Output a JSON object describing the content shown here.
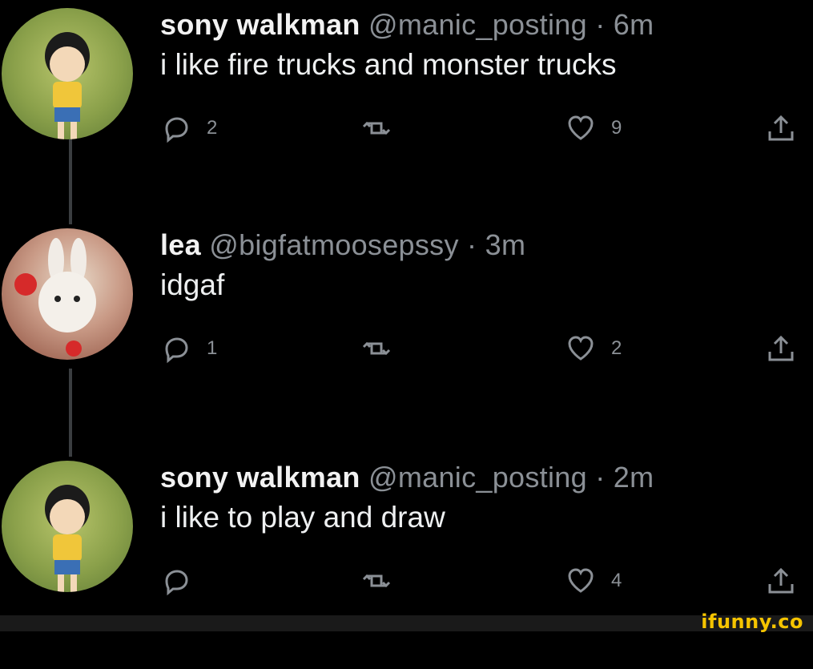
{
  "tweets": [
    {
      "name": "sony walkman",
      "handle": "@manic_posting · 6m",
      "text": "i like fire trucks and monster trucks",
      "replies": "2",
      "retweets": "",
      "likes": "9"
    },
    {
      "name": "lea",
      "handle": "@bigfatmoosepssy · 3m",
      "text": "idgaf",
      "replies": "1",
      "retweets": "",
      "likes": "2"
    },
    {
      "name": "sony walkman",
      "handle": "@manic_posting · 2m",
      "text": "i like to play and draw",
      "replies": "",
      "retweets": "",
      "likes": "4"
    }
  ],
  "watermark": "ifunny.co",
  "colors": {
    "background": "#000000",
    "muted": "#8b9096",
    "watermark": "#f5c400"
  }
}
